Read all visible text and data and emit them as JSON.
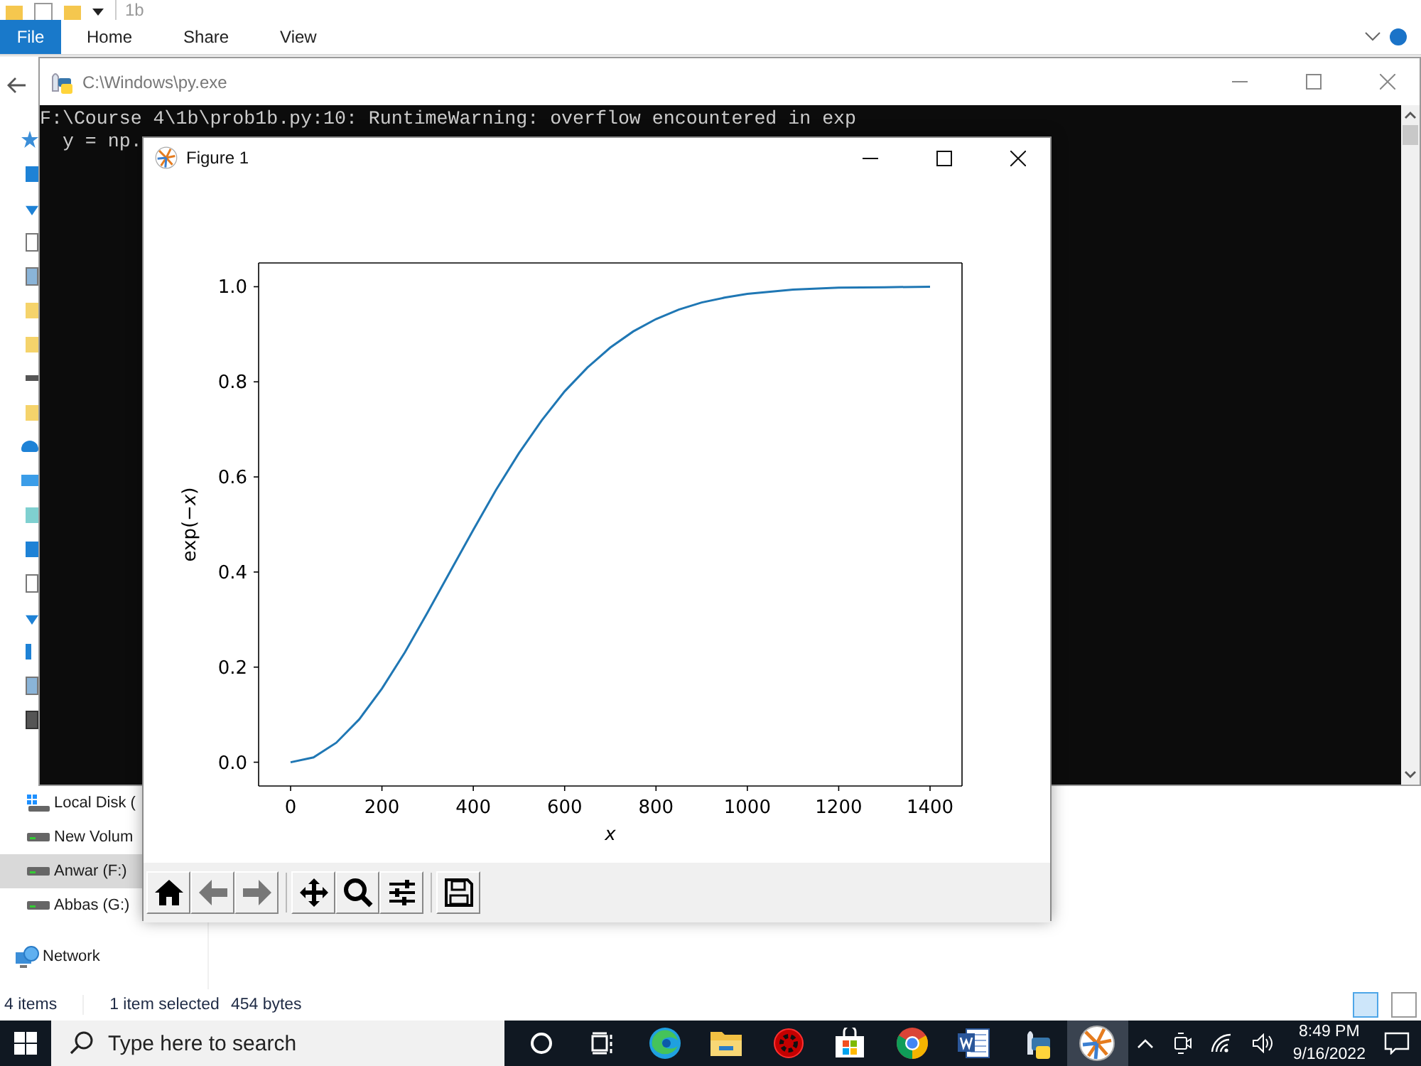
{
  "explorer": {
    "title": "1b",
    "ribbon_tabs": [
      {
        "label": "File",
        "selected": true
      },
      {
        "label": "Home",
        "selected": false
      },
      {
        "label": "Share",
        "selected": false
      },
      {
        "label": "View",
        "selected": false
      }
    ],
    "nav_items": [
      {
        "label": "Local Disk (",
        "kind": "system-drive",
        "selected": false
      },
      {
        "label": "New Volum",
        "kind": "drive",
        "selected": false
      },
      {
        "label": "Anwar (F:)",
        "kind": "drive",
        "selected": true
      },
      {
        "label": "Abbas (G:)",
        "kind": "drive",
        "selected": false
      },
      {
        "label": "Network",
        "kind": "network",
        "selected": false
      }
    ],
    "status_bar": {
      "item_count": "4 items",
      "selection": "1 item selected",
      "size": "454 bytes"
    }
  },
  "console": {
    "title": "C:\\Windows\\py.exe",
    "lines": [
      "F:\\Course 4\\1b\\prob1b.py:10: RuntimeWarning: overflow encountered in exp",
      "  y = np."
    ]
  },
  "figure": {
    "title": "Figure 1",
    "chart_data": {
      "type": "line",
      "xlabel": "x",
      "ylabel": "exp(−*x*)",
      "x": [
        0,
        50,
        100,
        150,
        200,
        250,
        300,
        350,
        400,
        450,
        500,
        550,
        600,
        650,
        700,
        750,
        800,
        850,
        900,
        950,
        1000,
        1100,
        1200,
        1300,
        1400
      ],
      "series": [
        {
          "color": "#1f77b4",
          "values": [
            0,
            0.01,
            0.041,
            0.09,
            0.155,
            0.231,
            0.315,
            0.402,
            0.489,
            0.573,
            0.65,
            0.719,
            0.78,
            0.83,
            0.872,
            0.906,
            0.932,
            0.952,
            0.967,
            0.977,
            0.985,
            0.994,
            0.998,
            0.999,
            1
          ]
        }
      ],
      "xlim": [
        -70,
        1470
      ],
      "ylim": [
        -0.05,
        1.05
      ],
      "xticks": [
        0,
        200,
        400,
        600,
        800,
        1000,
        1200,
        1400
      ],
      "yticks": [
        {
          "value": 0,
          "label": "0.0"
        },
        {
          "value": 0.2,
          "label": "0.2"
        },
        {
          "value": 0.4,
          "label": "0.4"
        },
        {
          "value": 0.6,
          "label": "0.6"
        },
        {
          "value": 0.8,
          "label": "0.8"
        },
        {
          "value": 1,
          "label": "1.0"
        }
      ]
    },
    "toolbar": [
      {
        "kind": "home"
      },
      {
        "kind": "back"
      },
      {
        "kind": "forward"
      },
      {
        "kind": "separator"
      },
      {
        "kind": "pan"
      },
      {
        "kind": "zoom"
      },
      {
        "kind": "configure"
      },
      {
        "kind": "separator"
      },
      {
        "kind": "save"
      }
    ]
  },
  "taskbar": {
    "search": {
      "placeholder": "Type here to search"
    },
    "apps": [
      {
        "kind": "cortana",
        "selected": false
      },
      {
        "kind": "task-view",
        "selected": false
      },
      {
        "kind": "edge",
        "selected": false
      },
      {
        "kind": "explorer",
        "selected": false
      },
      {
        "kind": "gear",
        "selected": false
      },
      {
        "kind": "store",
        "selected": false
      },
      {
        "kind": "chrome",
        "selected": false
      },
      {
        "kind": "word",
        "selected": false
      },
      {
        "kind": "python",
        "selected": false
      },
      {
        "kind": "figure",
        "selected": true
      }
    ],
    "time": "8:49 PM",
    "date": "9/16/2022"
  }
}
